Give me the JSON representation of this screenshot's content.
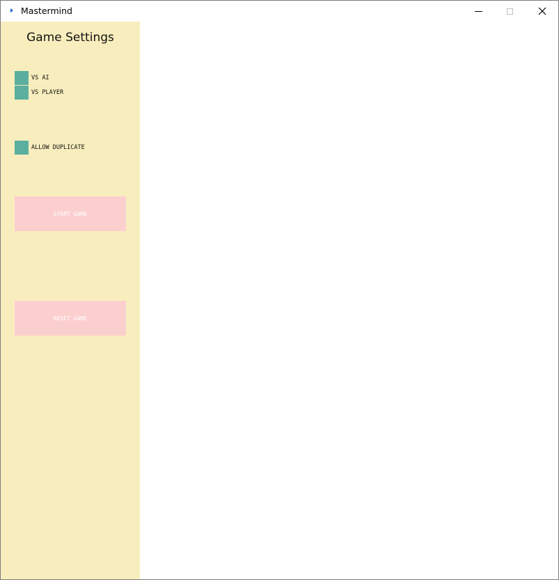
{
  "window": {
    "title": "Mastermind",
    "icons": {
      "app": "app-icon",
      "minimize": "minimize-icon",
      "maximize": "maximize-icon",
      "close": "close-icon"
    }
  },
  "sidebar": {
    "title": "Game Settings",
    "options": [
      {
        "label": "VS AI",
        "checked": false
      },
      {
        "label": "VS PLAYER",
        "checked": false
      },
      {
        "label": "ALLOW DUPLICATE",
        "checked": false
      }
    ],
    "start_label": "START GAME",
    "reset_label": "RESET GAME"
  },
  "colors": {
    "sidebar_bg": "#f8eebd",
    "checkbox": "#5aaf9e",
    "button_bg": "#fccfcf",
    "button_text": "#ffffff"
  }
}
